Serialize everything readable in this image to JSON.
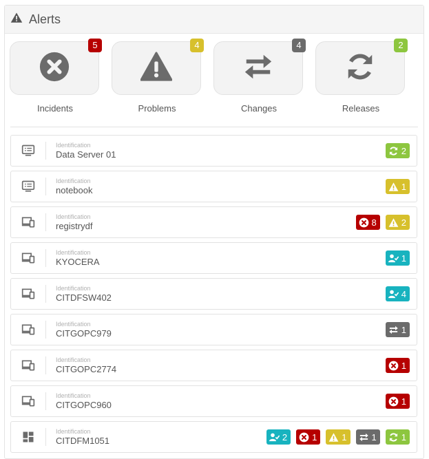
{
  "header": {
    "title": "Alerts"
  },
  "summary": [
    {
      "key": "incidents",
      "label": "Incidents",
      "count": "5",
      "color": "#b60000"
    },
    {
      "key": "problems",
      "label": "Problems",
      "count": "4",
      "color": "#d7c02c"
    },
    {
      "key": "changes",
      "label": "Changes",
      "count": "4",
      "color": "#6b6b6b"
    },
    {
      "key": "releases",
      "label": "Releases",
      "count": "2",
      "color": "#8dc63f"
    }
  ],
  "colors": {
    "incident": "#b60000",
    "problem": "#d7c02c",
    "change": "#6b6b6b",
    "release": "#8dc63f",
    "request": "#18b3bf",
    "icon": "#6b6b6b"
  },
  "id_label": "Identification",
  "rows": [
    {
      "type": "server-icon",
      "name": "Data Server 01",
      "badges": [
        {
          "kind": "release",
          "count": "2"
        }
      ]
    },
    {
      "type": "server-icon",
      "name": "notebook",
      "badges": [
        {
          "kind": "problem",
          "count": "1"
        }
      ]
    },
    {
      "type": "devices-icon",
      "name": "registrydf",
      "badges": [
        {
          "kind": "incident",
          "count": "8"
        },
        {
          "kind": "problem",
          "count": "2"
        }
      ]
    },
    {
      "type": "devices-icon",
      "name": "KYOCERA",
      "badges": [
        {
          "kind": "request",
          "count": "1"
        }
      ]
    },
    {
      "type": "devices-icon",
      "name": "CITDFSW402",
      "badges": [
        {
          "kind": "request",
          "count": "4"
        }
      ]
    },
    {
      "type": "devices-icon",
      "name": "CITGOPC979",
      "badges": [
        {
          "kind": "change",
          "count": "1"
        }
      ]
    },
    {
      "type": "devices-icon",
      "name": "CITGOPC2774",
      "badges": [
        {
          "kind": "incident",
          "count": "1"
        }
      ]
    },
    {
      "type": "devices-icon",
      "name": "CITGOPC960",
      "badges": [
        {
          "kind": "incident",
          "count": "1"
        }
      ]
    },
    {
      "type": "grid-icon",
      "name": "CITDFM1051",
      "badges": [
        {
          "kind": "request",
          "count": "2"
        },
        {
          "kind": "incident",
          "count": "1"
        },
        {
          "kind": "problem",
          "count": "1"
        },
        {
          "kind": "change",
          "count": "1"
        },
        {
          "kind": "release",
          "count": "1"
        }
      ]
    }
  ]
}
